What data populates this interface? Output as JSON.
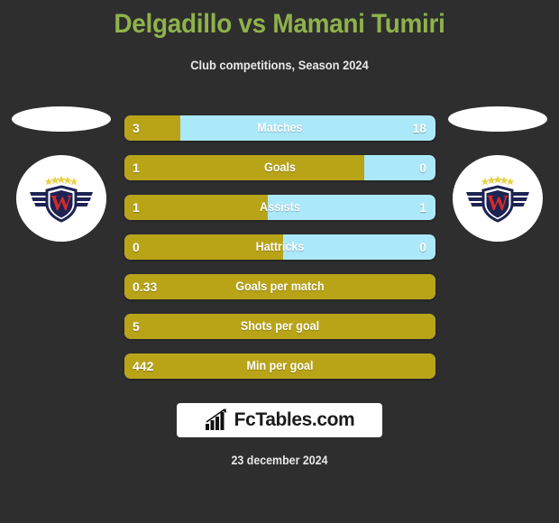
{
  "header": {
    "title": "Delgadillo vs Mamani Tumiri",
    "subtitle": "Club competitions, Season 2024",
    "title_color": "#8fb24b"
  },
  "colors": {
    "background": "#2e2e2e",
    "home_bar": "#b9a418",
    "away_bar": "#abe9fa",
    "text": "#ffffff"
  },
  "teams": {
    "left": {
      "crest_name": "jorge-wilstermann-crest",
      "crest_letter": "W",
      "crest_stars": 5
    },
    "right": {
      "crest_name": "jorge-wilstermann-crest",
      "crest_letter": "W",
      "crest_stars": 5
    }
  },
  "stats": [
    {
      "label": "Matches",
      "home": "3",
      "away": "18",
      "home_pct": 18,
      "dual": true
    },
    {
      "label": "Goals",
      "home": "1",
      "away": "0",
      "home_pct": 77,
      "dual": true
    },
    {
      "label": "Assists",
      "home": "1",
      "away": "1",
      "home_pct": 46,
      "dual": true
    },
    {
      "label": "Hattricks",
      "home": "0",
      "away": "0",
      "home_pct": 51,
      "dual": true
    },
    {
      "label": "Goals per match",
      "home": "0.33",
      "away": "",
      "home_pct": 100,
      "dual": false
    },
    {
      "label": "Shots per goal",
      "home": "5",
      "away": "",
      "home_pct": 100,
      "dual": false
    },
    {
      "label": "Min per goal",
      "home": "442",
      "away": "",
      "home_pct": 100,
      "dual": false
    }
  ],
  "footer": {
    "logo_text": "FcTables.com",
    "logo_icon": "bar-chart-arrow-icon",
    "date": "23 december 2024"
  }
}
